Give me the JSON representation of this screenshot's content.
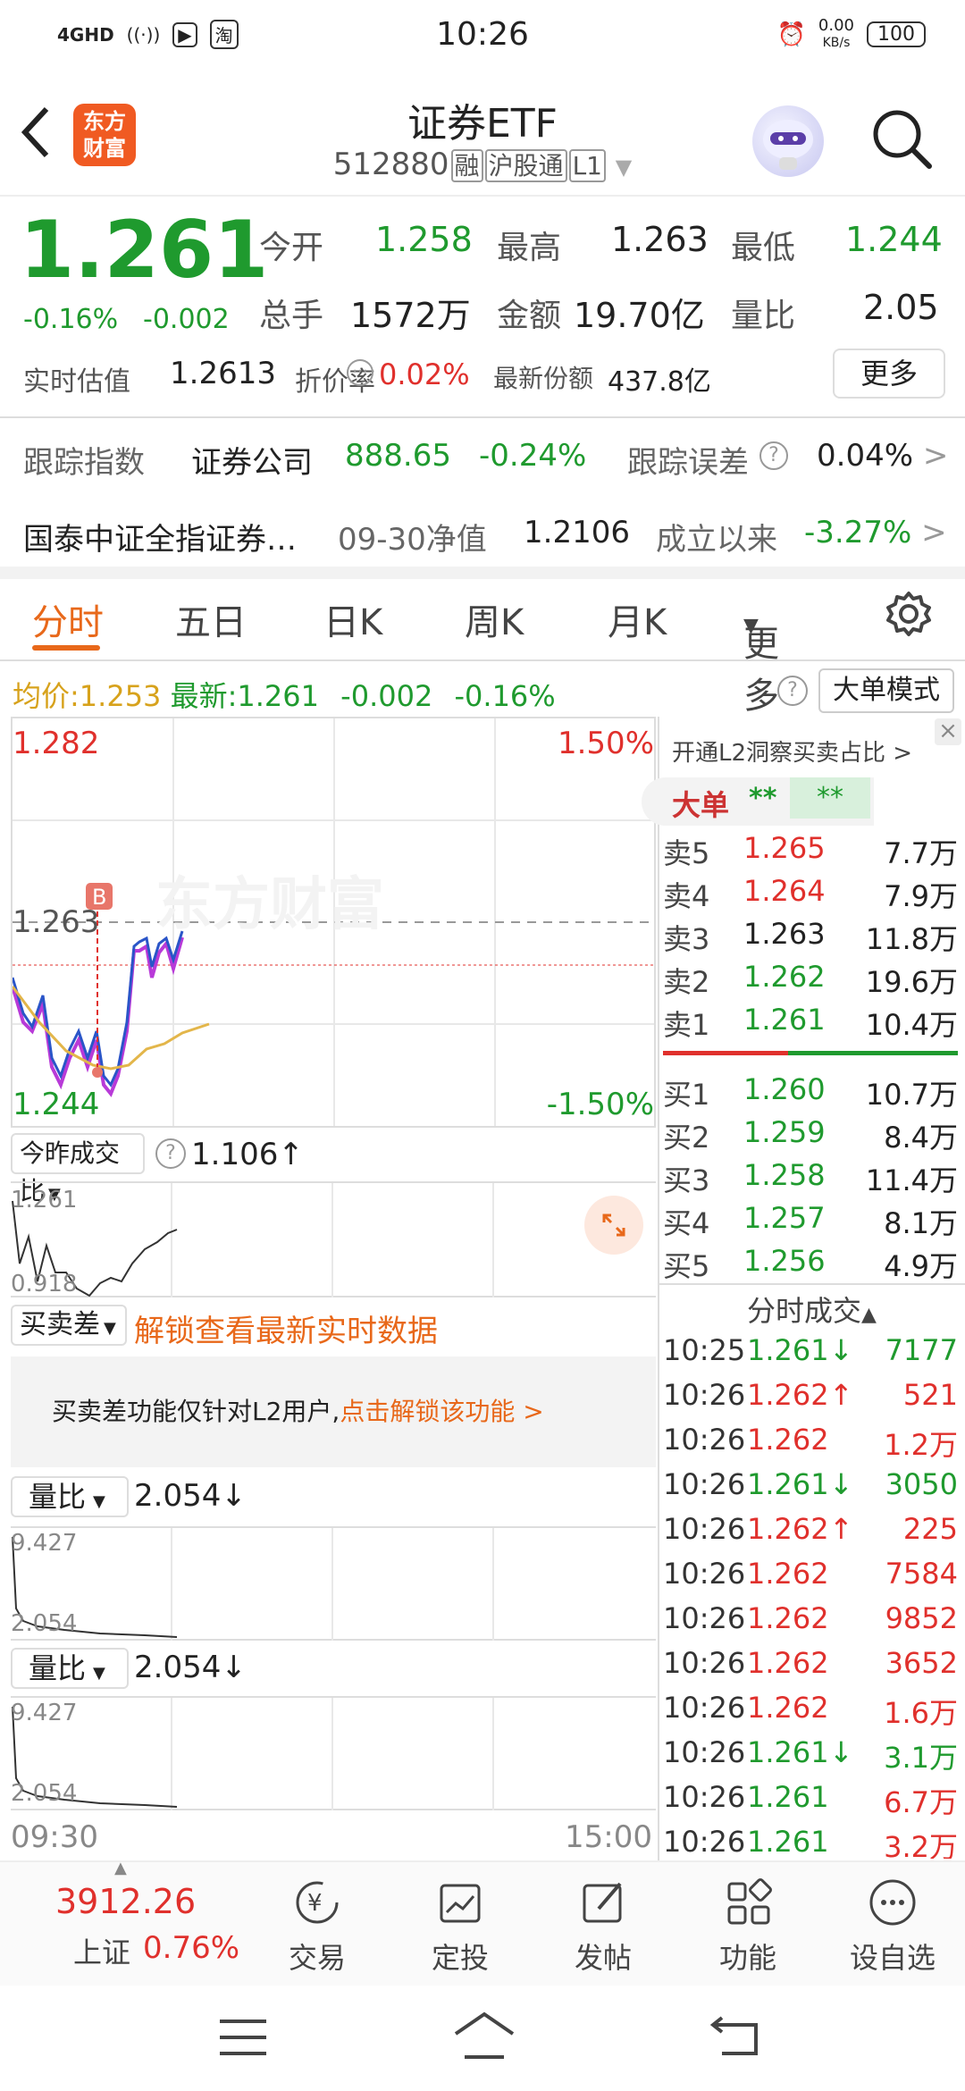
{
  "status_bar": {
    "network": "4GHD",
    "time": "10:26",
    "speed": "0.00",
    "speed_unit": "KB/s",
    "battery": "100"
  },
  "header": {
    "logo_line1": "东方",
    "logo_line2": "财富",
    "title": "证券ETF",
    "code": "512880",
    "tag1": "融",
    "tag2": "沪股通",
    "tag3": "L1"
  },
  "quote": {
    "price": "1.261",
    "change_pct": "-0.16%",
    "change": "-0.002",
    "open_label": "今开",
    "open": "1.258",
    "high_label": "最高",
    "high": "1.263",
    "low_label": "最低",
    "low": "1.244",
    "vol_label": "总手",
    "vol": "1572万",
    "amount_label": "金额",
    "amount": "19.70亿",
    "ratio_label": "量比",
    "ratio": "2.05",
    "iopv_label": "实时估值",
    "iopv": "1.2613",
    "discount_label": "折价率",
    "discount": "0.02%",
    "shares_label": "最新份额",
    "shares": "437.8亿",
    "more": "更多"
  },
  "tracking": {
    "label": "跟踪指数",
    "index": "证券公司",
    "index_val": "888.65",
    "index_chg": "-0.24%",
    "err_label": "跟踪误差",
    "err": "0.04%"
  },
  "fund": {
    "name": "国泰中证全指证券…",
    "nav_label": "09-30净值",
    "nav": "1.2106",
    "since_label": "成立以来",
    "since": "-3.27%"
  },
  "tabs": [
    "分时",
    "五日",
    "日K",
    "周K",
    "月K",
    "更多"
  ],
  "avg_line": {
    "avg_label": "均价:",
    "avg": "1.253",
    "last_label": "最新:",
    "last": "1.261",
    "chg": "-0.002",
    "pct": "-0.16%",
    "mode": "大单模式"
  },
  "chart": {
    "top": "1.282",
    "top_pct": "1.50%",
    "mid": "1.263",
    "bottom": "1.244",
    "bottom_pct": "-1.50%",
    "marker": "B",
    "watermark": "东方财富",
    "start_time": "09:30",
    "end_time": "15:00"
  },
  "sub1": {
    "label": "今昨成交比",
    "value": "1.106↑",
    "top": "1.261",
    "bottom": "0.918"
  },
  "sub2": {
    "label": "买卖差",
    "unlock": "解锁查看最新实时数据",
    "msg": "买卖差功能仅针对L2用户,",
    "msg_link": "点击解锁该功能 >"
  },
  "sub3": {
    "label": "量比",
    "value": "2.054↓",
    "top": "9.427",
    "bottom": "2.054"
  },
  "sub4": {
    "label": "量比",
    "value": "2.054↓",
    "top": "9.427",
    "bottom": "2.054"
  },
  "l2_banner": "开通L2洞察买卖占比",
  "bigorder": {
    "label": "大单",
    "v1": "**",
    "v2": "**"
  },
  "asks": [
    {
      "l": "卖5",
      "p": "1.265",
      "v": "7.7万"
    },
    {
      "l": "卖4",
      "p": "1.264",
      "v": "7.9万"
    },
    {
      "l": "卖3",
      "p": "1.263",
      "v": "11.8万"
    },
    {
      "l": "卖2",
      "p": "1.262",
      "v": "19.6万"
    },
    {
      "l": "卖1",
      "p": "1.261",
      "v": "10.4万"
    }
  ],
  "bids": [
    {
      "l": "买1",
      "p": "1.260",
      "v": "10.7万"
    },
    {
      "l": "买2",
      "p": "1.259",
      "v": "8.4万"
    },
    {
      "l": "买3",
      "p": "1.258",
      "v": "11.4万"
    },
    {
      "l": "买4",
      "p": "1.257",
      "v": "8.1万"
    },
    {
      "l": "买5",
      "p": "1.256",
      "v": "4.9万"
    }
  ],
  "trades_title": "分时成交",
  "trades": [
    {
      "t": "10:25",
      "p": "1.261",
      "d": "↓",
      "v": "7177"
    },
    {
      "t": "10:26",
      "p": "1.262",
      "d": "↑",
      "v": "521"
    },
    {
      "t": "10:26",
      "p": "1.262",
      "d": "",
      "v": "1.2万"
    },
    {
      "t": "10:26",
      "p": "1.261",
      "d": "↓",
      "v": "3050"
    },
    {
      "t": "10:26",
      "p": "1.262",
      "d": "↑",
      "v": "225"
    },
    {
      "t": "10:26",
      "p": "1.262",
      "d": "",
      "v": "7584"
    },
    {
      "t": "10:26",
      "p": "1.262",
      "d": "",
      "v": "9852"
    },
    {
      "t": "10:26",
      "p": "1.262",
      "d": "",
      "v": "3652"
    },
    {
      "t": "10:26",
      "p": "1.262",
      "d": "",
      "v": "1.6万"
    },
    {
      "t": "10:26",
      "p": "1.261",
      "d": "↓",
      "v": "3.1万"
    },
    {
      "t": "10:26",
      "p": "1.261",
      "d": "",
      "v": "6.7万"
    },
    {
      "t": "10:26",
      "p": "1.261",
      "d": "",
      "v": "3.2万"
    }
  ],
  "bottom": {
    "index_val": "3912.26",
    "index_name": "上证",
    "index_chg": "0.76%",
    "items": [
      "交易",
      "定投",
      "发帖",
      "功能",
      "设自选"
    ]
  },
  "colors": {
    "up": "#e0302c",
    "down": "#1f9a2e",
    "accent": "#e8681a"
  }
}
